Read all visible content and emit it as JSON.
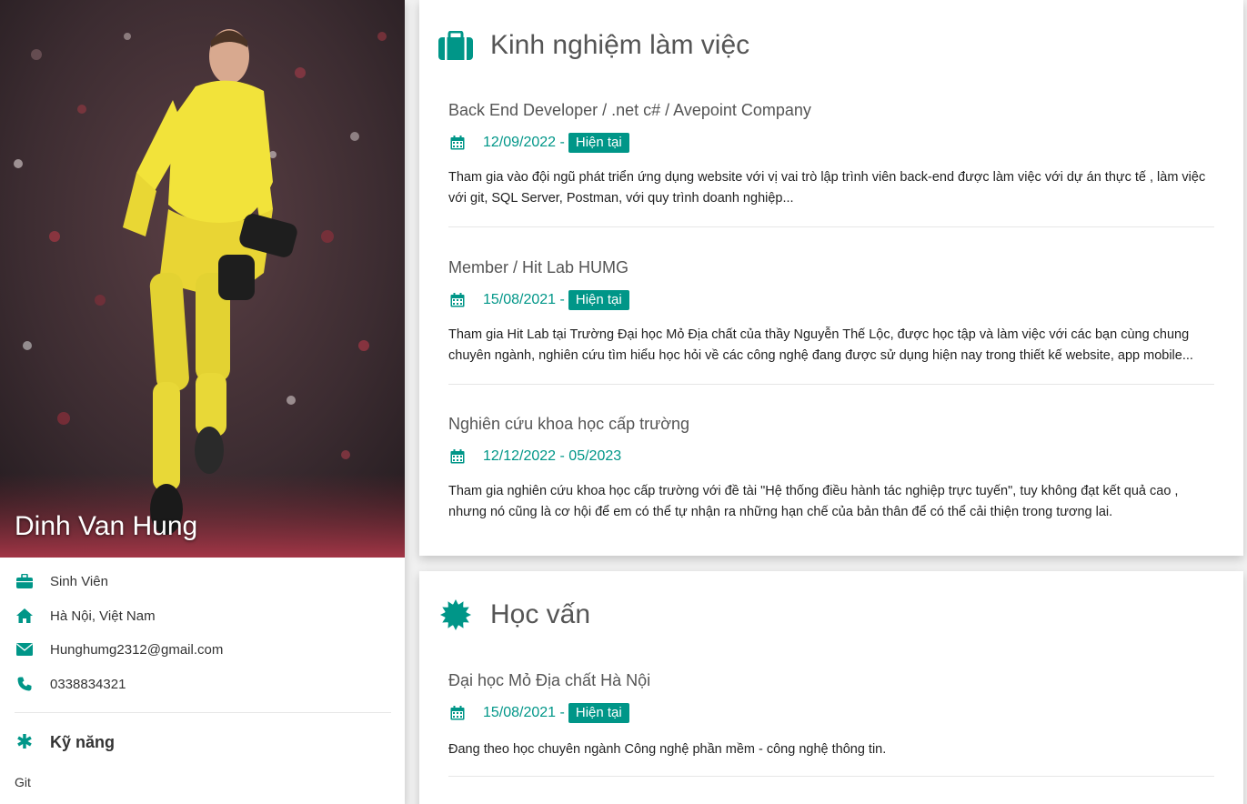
{
  "profile": {
    "name": "Dinh Van Hung",
    "info": [
      {
        "icon": "briefcase-icon",
        "text": "Sinh Viên"
      },
      {
        "icon": "home-icon",
        "text": "Hà Nội, Việt Nam"
      },
      {
        "icon": "envelope-icon",
        "text": "Hunghumg2312@gmail.com"
      },
      {
        "icon": "phone-icon",
        "text": "0338834321"
      }
    ],
    "skills_title": "Kỹ năng",
    "skills": [
      "Git"
    ]
  },
  "experience": {
    "title": "Kinh nghiệm làm việc",
    "entries": [
      {
        "title": "Back End Developer / .net c# / Avepoint Company",
        "date": "12/09/2022 -",
        "tag": "Hiện tại",
        "desc": "Tham gia vào đội ngũ phát triển ứng dụng website với vị vai trò lập trình viên back-end được làm việc với dự án thực tế , làm việc với git, SQL Server, Postman, với quy trình doanh nghiệp..."
      },
      {
        "title": "Member / Hit Lab HUMG",
        "date": "15/08/2021 -",
        "tag": "Hiện tại",
        "desc": "Tham gia Hit Lab tại Trường Đại học Mỏ Địa chất của thầy Nguyễn Thế Lộc, được học tập và làm việc với các bạn cùng chung chuyên ngành, nghiên cứu tìm hiểu học hỏi về các công nghệ đang được sử dụng hiện nay trong thiết kế website, app mobile..."
      },
      {
        "title": "Nghiên cứu khoa học cấp trường",
        "date": "12/12/2022 - 05/2023",
        "tag": "",
        "desc": "Tham gia nghiên cứu khoa học cấp trường với đề tài \"Hệ thống điều hành tác nghiệp trực tuyến\", tuy không đạt kết quả cao , nhưng nó cũng là cơ hội để em có thể tự nhận ra những hạn chế của bản thân để có thể cải thiện trong tương lai."
      }
    ]
  },
  "education": {
    "title": "Học vấn",
    "entries": [
      {
        "title": "Đại học Mỏ Địa chất Hà Nội",
        "date": "15/08/2021 -",
        "tag": "Hiện tại",
        "desc": "Đang theo học chuyên ngành Công nghệ phần mềm - công nghệ thông tin."
      }
    ]
  },
  "colors": {
    "accent": "#009688",
    "muted_text": "#555555"
  }
}
